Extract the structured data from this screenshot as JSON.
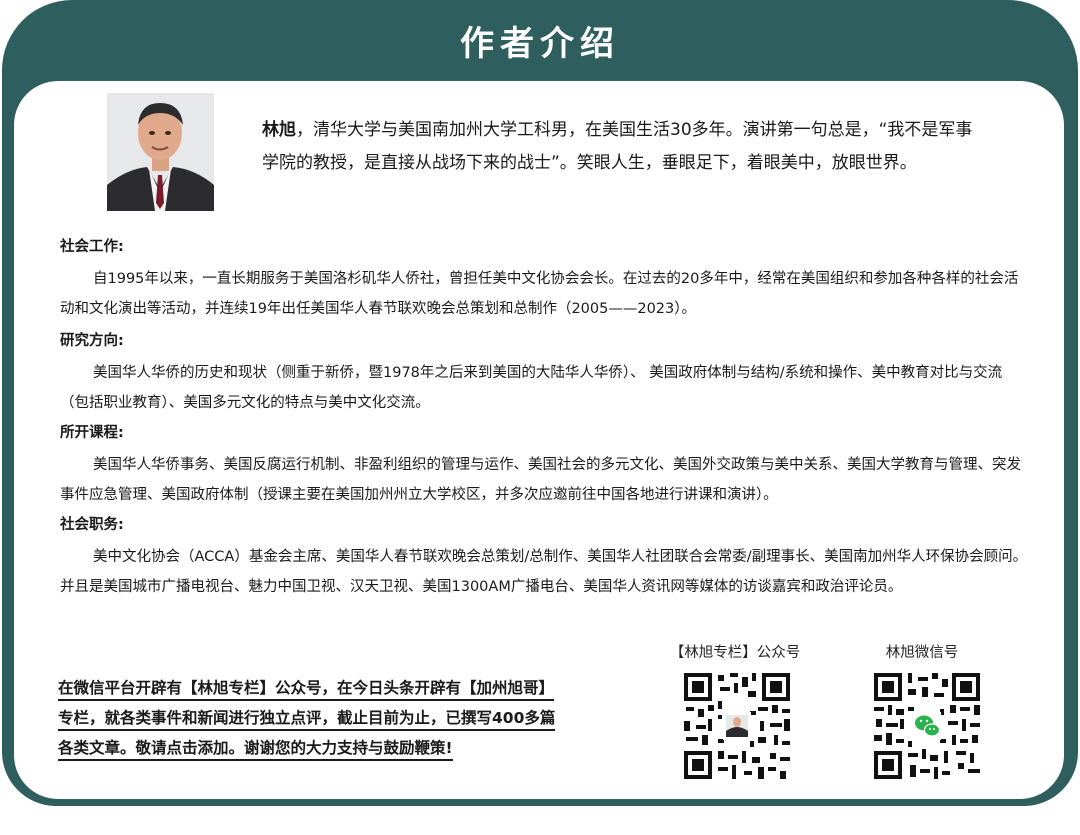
{
  "header": {
    "title": "作者介绍"
  },
  "author": {
    "name": "林旭",
    "intro_rest": "，清华大学与美国南加州大学工科男，在美国生活30多年。演讲第一句总是，“我不是军事学院的教授，是直接从战场下来的战士”。笑眼人生，垂眼足下，着眼美中，放眼世界。"
  },
  "sections": [
    {
      "heading": "社会工作:",
      "body": "自1995年以来，一直长期服务于美国洛杉矶华人侨社，曾担任美中文化协会会长。在过去的20多年中，经常在美国组织和参加各种各样的社会活动和文化演出等活动，并连续19年出任美国华人春节联欢晚会总策划和总制作（2005——2023）。"
    },
    {
      "heading": "研究方向:",
      "body": "美国华人华侨的历史和现状（侧重于新侨，暨1978年之后来到美国的大陆华人华侨）、 美国政府体制与结构/系统和操作、美中教育对比与交流（包括职业教育）、美国多元文化的特点与美中文化交流。"
    },
    {
      "heading": "所开课程:",
      "body": "美国华人华侨事务、美国反腐运行机制、非盈利组织的管理与运作、美国社会的多元文化、美国外交政策与美中关系、美国大学教育与管理、突发事件应急管理、美国政府体制（授课主要在美国加州州立大学校区，并多次应邀前往中国各地进行讲课和演讲）。"
    },
    {
      "heading": "社会职务:",
      "body": "美中文化协会（ACCA）基金会主席、美国华人春节联欢晚会总策划/总制作、美国华人社团联合会常委/副理事长、美国南加州华人环保协会顾问。并且是美国城市广播电视台、魅力中国卫视、汉天卫视、美国1300AM广播电台、美国华人资讯网等媒体的访谈嘉宾和政治评论员。"
    }
  ],
  "footer": {
    "line1": "在微信平台开辟有【林旭专栏】公众号，在今日头条开辟有【加州旭哥】",
    "line2": "专栏，就各类事件和新闻进行独立点评，截止目前为止，已撰写400多篇",
    "line3": "各类文章。敬请点击添加。谢谢您的大力支持与鼓励鞭策!"
  },
  "qr_codes": [
    {
      "label": "【林旭专栏】公众号",
      "center_icon": "portrait-icon"
    },
    {
      "label": "林旭微信号",
      "center_icon": "wechat-icon"
    }
  ],
  "colors": {
    "frame": "#2e5e5e",
    "text": "#1a1a1a",
    "wechat_green": "#2bb24c"
  }
}
